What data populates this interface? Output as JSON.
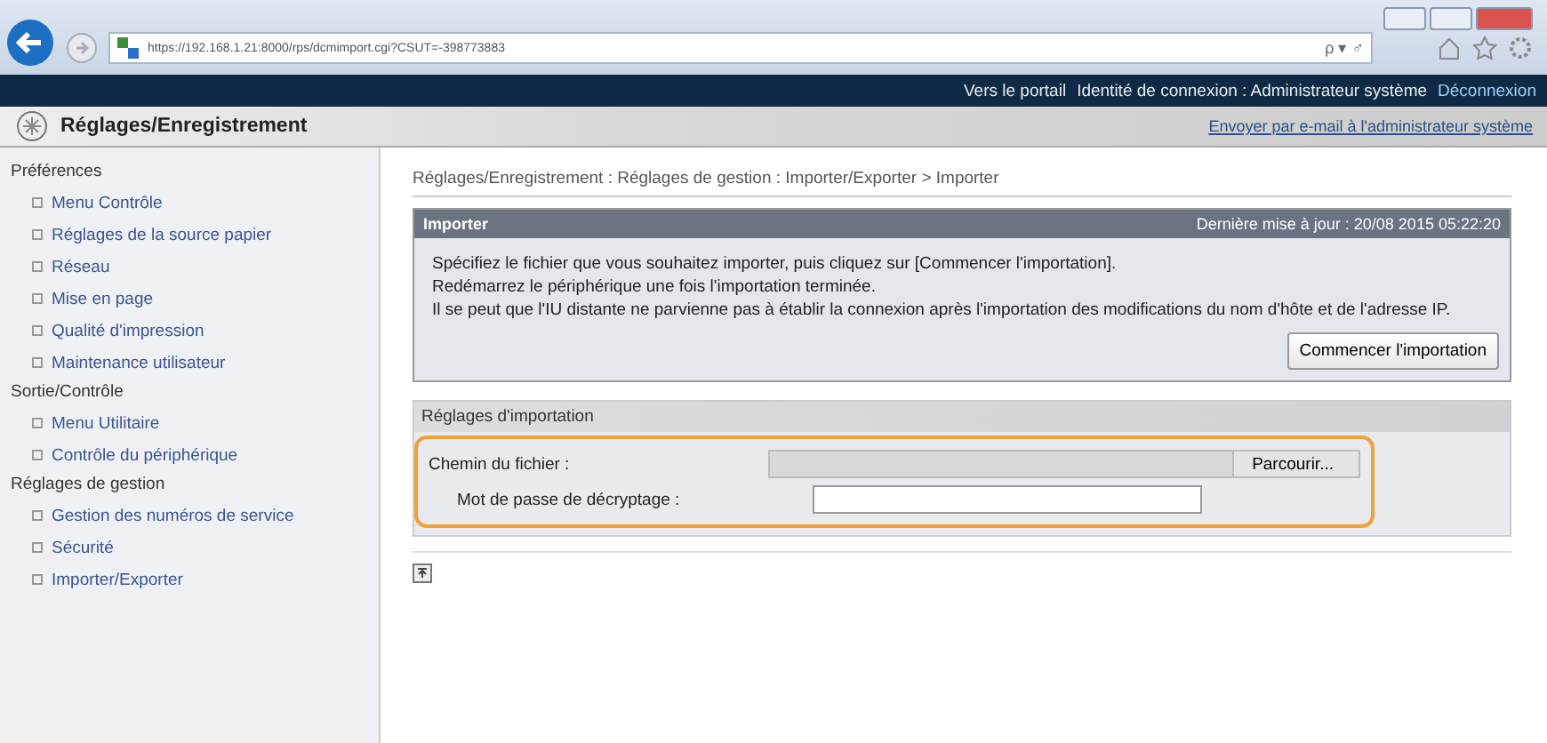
{
  "browser": {
    "url": "https://192.168.1.21:8000/rps/dcmimport.cgi?CSUT=-398773883",
    "search_symbol": "ρ ▾ ♂"
  },
  "top_bar": {
    "links": [
      "Vers le portail",
      "Identité de connexion : Administrateur système",
      "Déconnexion"
    ]
  },
  "header": {
    "title": "Réglages/Enregistrement",
    "mail_link": "Envoyer par e-mail à l'administrateur système"
  },
  "sidebar": {
    "sections": [
      {
        "title": "Préférences",
        "items": [
          "Menu Contrôle",
          "Réglages de la source papier",
          "Réseau",
          "Mise en page",
          "Qualité d'impression",
          "Maintenance utilisateur"
        ]
      },
      {
        "title": "Sortie/Contrôle",
        "items": [
          "Menu Utilitaire",
          "Contrôle du périphérique"
        ]
      },
      {
        "title": "Réglages de gestion",
        "items": [
          "Gestion des numéros de service",
          "Sécurité",
          "Importer/Exporter"
        ]
      }
    ]
  },
  "breadcrumb": "Réglages/Enregistrement : Réglages de gestion : Importer/Exporter > Importer",
  "panel": {
    "title": "Importer",
    "updated": "Dernière mise à jour : 20/08 2015 05:22:20",
    "messages": [
      "Spécifiez le fichier que vous souhaitez importer, puis cliquez sur [Commencer l'importation].",
      "Redémarrez le périphérique une fois l'importation terminée.",
      "Il se peut que l'IU distante ne parvienne pas à établir la connexion après l'importation des modifications du nom d'hôte et de l'adresse IP."
    ],
    "button": "Commencer l'importation"
  },
  "settings": {
    "title": "Réglages d'importation",
    "file_label": "Chemin du fichier :",
    "browse": "Parcourir...",
    "password_label": "Mot de passe de décryptage :",
    "highlighted": true
  }
}
